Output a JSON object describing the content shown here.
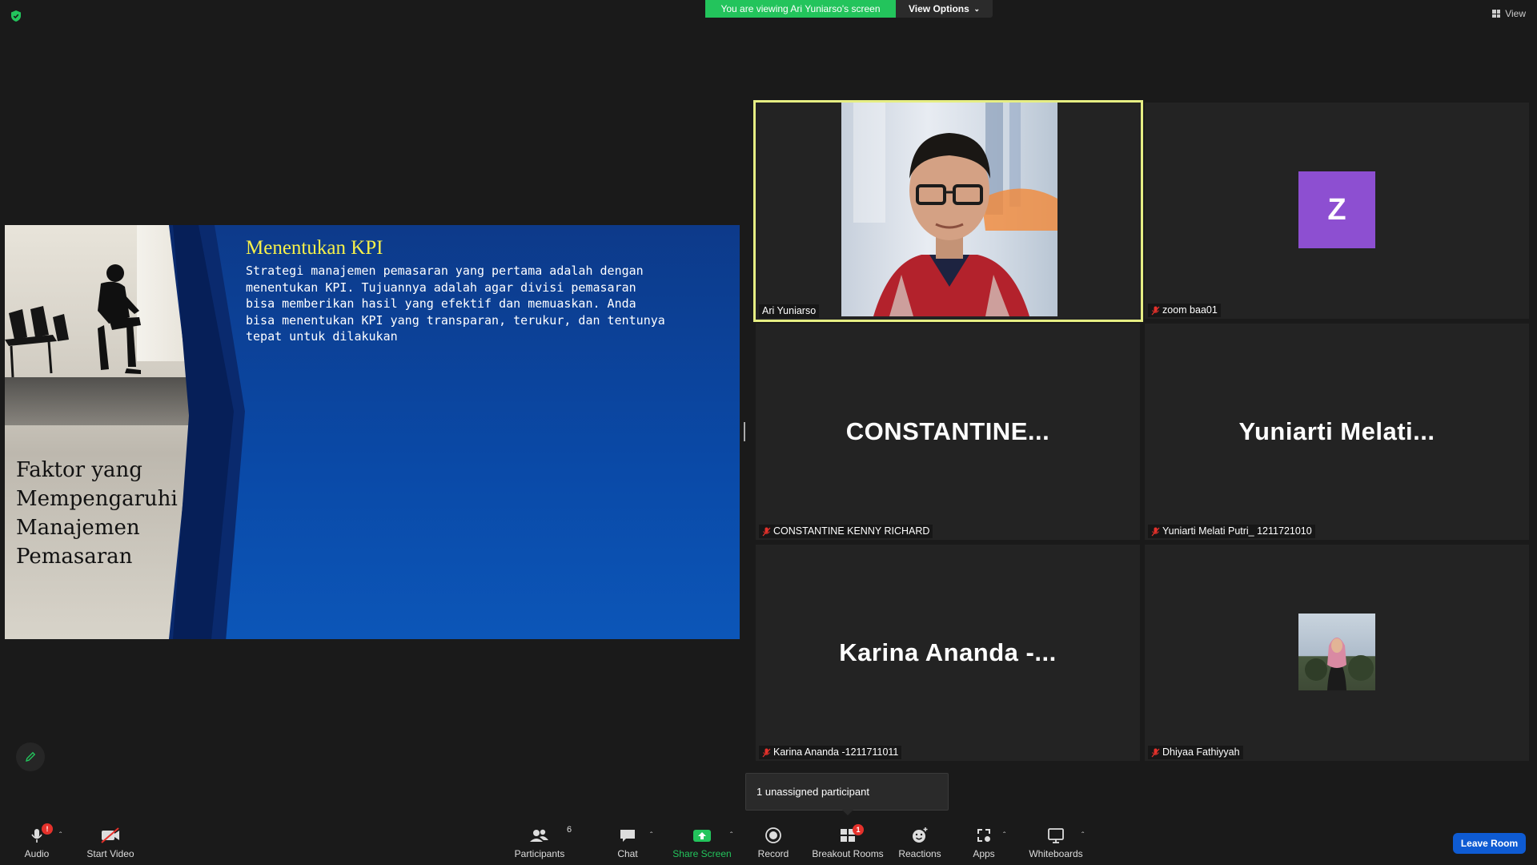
{
  "top": {
    "viewing_text": "You are viewing Ari Yuniarso's screen",
    "view_options_label": "View Options",
    "view_label": "View"
  },
  "slide": {
    "title": "Menentukan KPI",
    "body": "Strategi manajemen pemasaran yang pertama adalah dengan\nmenentukan KPI. Tujuannya adalah agar divisi pemasaran\nbisa memberikan hasil yang efektif dan memuaskan. Anda\nbisa menentukan KPI yang transparan, terukur, dan tentunya\ntepat untuk dilakukan",
    "left_title": "Faktor yang Mempengaruhi Manajemen Pemasaran"
  },
  "participants": [
    {
      "label": "Ari Yuniarso",
      "muted": false,
      "type": "video"
    },
    {
      "label": "zoom baa01",
      "muted": true,
      "type": "avatar",
      "initial": "Z"
    },
    {
      "label": "CONSTANTINE KENNY RICHARD",
      "muted": true,
      "type": "name",
      "big_name": "CONSTANTINE..."
    },
    {
      "label": "Yuniarti Melati Putri_ 1211721010",
      "muted": true,
      "type": "name",
      "big_name": "Yuniarti  Melati..."
    },
    {
      "label": "Karina Ananda -1211711011",
      "muted": true,
      "type": "name",
      "big_name": "Karina  Ananda  -..."
    },
    {
      "label": "Dhiyaa Fathiyyah",
      "muted": true,
      "type": "photo"
    }
  ],
  "popover": {
    "text": "1 unassigned participant"
  },
  "toolbar": {
    "audio": "Audio",
    "audio_badge": "!",
    "start_video": "Start Video",
    "participants": "Participants",
    "participants_count": "6",
    "chat": "Chat",
    "share_screen": "Share Screen",
    "record": "Record",
    "breakout_rooms": "Breakout Rooms",
    "breakout_badge": "1",
    "reactions": "Reactions",
    "apps": "Apps",
    "whiteboards": "Whiteboards",
    "leave_room": "Leave Room"
  },
  "colors": {
    "share_green": "#23c45c",
    "active_speaker": "#e6ee83",
    "avatar_purple": "#8d4fd1",
    "leave_blue": "#0e5bd3",
    "badge_red": "#e5312b"
  }
}
